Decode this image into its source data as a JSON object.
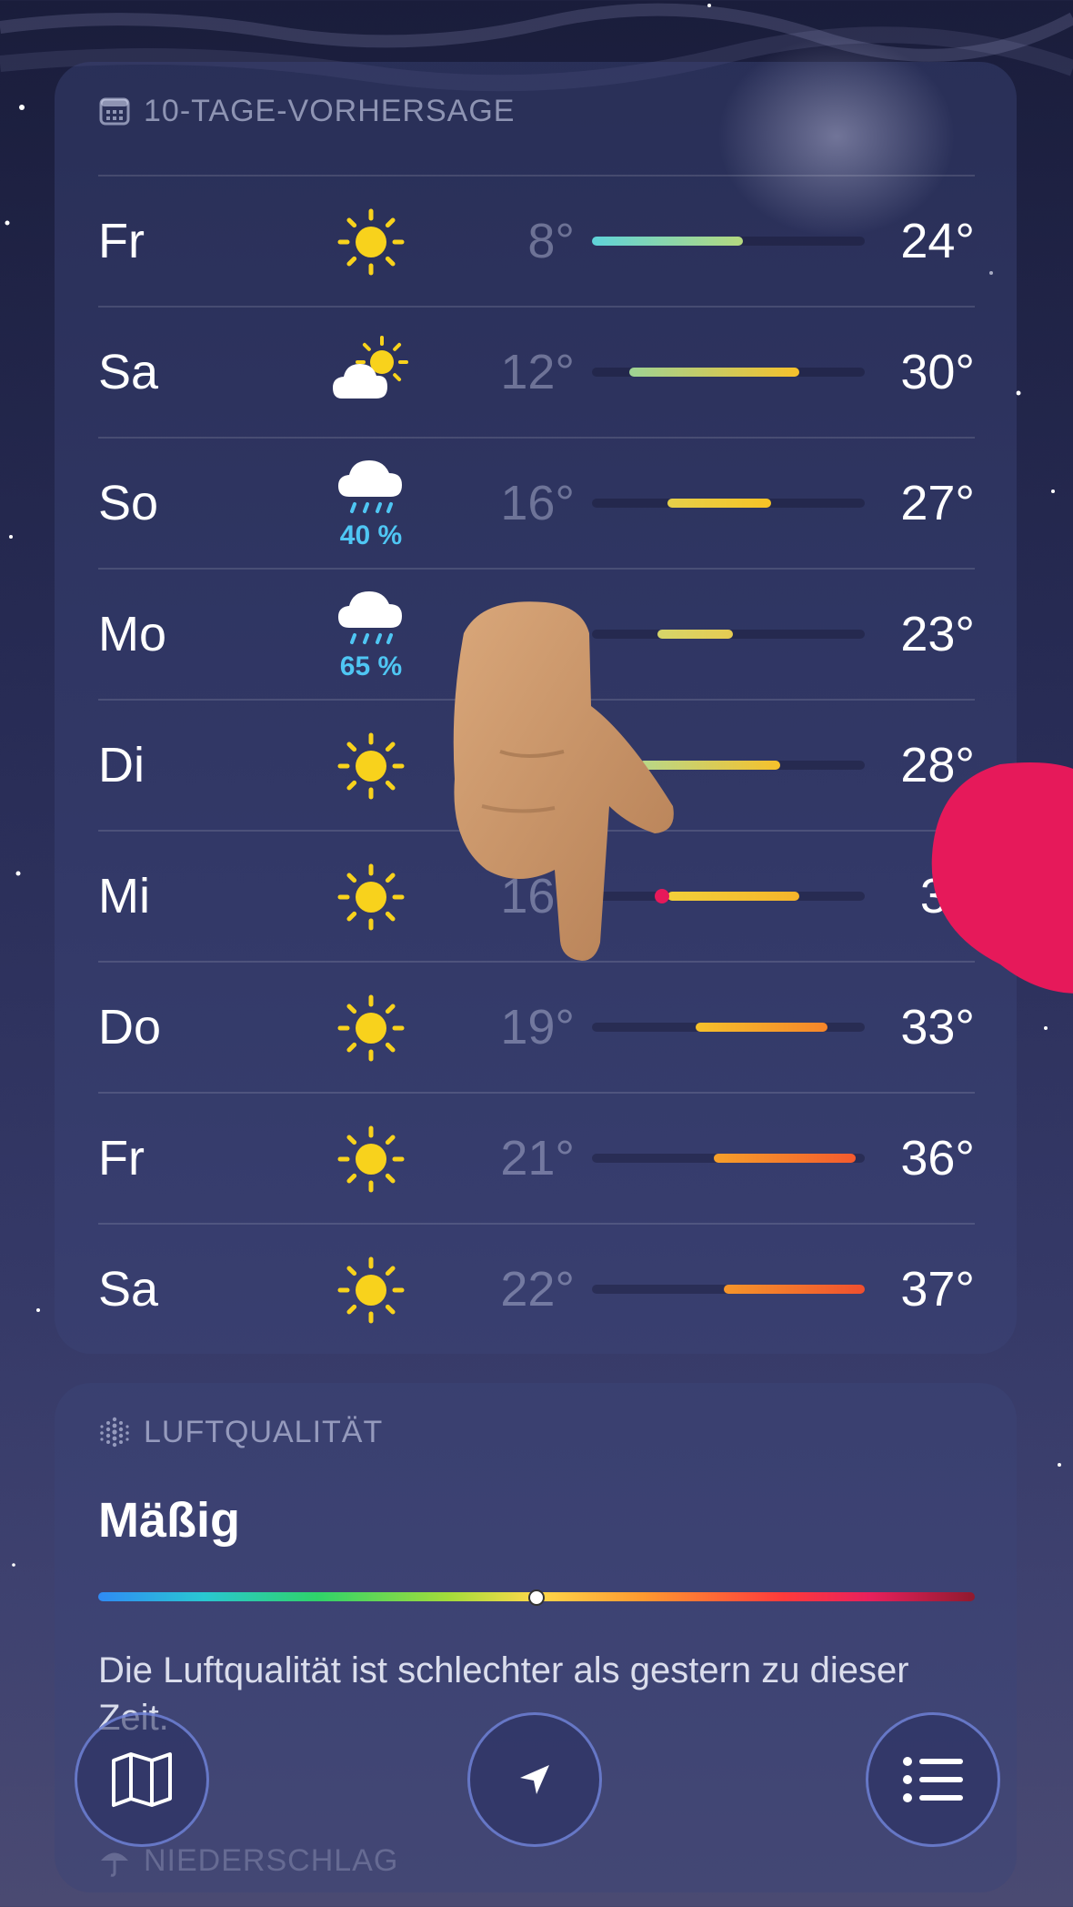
{
  "forecast": {
    "header": "10-TAGE-VORHERSAGE",
    "scale_min": 8,
    "scale_max": 37,
    "days": [
      {
        "day": "Fr",
        "icon": "sun-icon",
        "precip": "",
        "low": "8°",
        "high": "24°",
        "low_val": 8,
        "high_val": 24,
        "color_from": "#5fd3d9",
        "color_to": "#b5d97f"
      },
      {
        "day": "Sa",
        "icon": "partly-cloudy-icon",
        "precip": "",
        "low": "12°",
        "high": "30°",
        "low_val": 12,
        "high_val": 30,
        "color_from": "#9ed394",
        "color_to": "#f6c12b"
      },
      {
        "day": "So",
        "icon": "rain-cloud-icon",
        "precip": "40 %",
        "low": "16°",
        "high": "27°",
        "low_val": 16,
        "high_val": 27,
        "color_from": "#e6d04a",
        "color_to": "#f7c325"
      },
      {
        "day": "Mo",
        "icon": "rain-cloud-icon",
        "precip": "65 %",
        "low": "",
        "high": "23°",
        "low_val": 15,
        "high_val": 23,
        "color_from": "#d6d56a",
        "color_to": "#e6cc52"
      },
      {
        "day": "Di",
        "icon": "sun-icon",
        "precip": "",
        "low": "",
        "high": "28°",
        "low_val": 13,
        "high_val": 28,
        "color_from": "#b8d88a",
        "color_to": "#f6c12b"
      },
      {
        "day": "Mi",
        "icon": "sun-icon",
        "precip": "",
        "low": "16°",
        "high": "30",
        "low_val": 16,
        "high_val": 30,
        "color_from": "#f2d03a",
        "color_to": "#f6b42a"
      },
      {
        "day": "Do",
        "icon": "sun-icon",
        "precip": "",
        "low": "19°",
        "high": "33°",
        "low_val": 19,
        "high_val": 33,
        "color_from": "#f6c12b",
        "color_to": "#f6852a"
      },
      {
        "day": "Fr",
        "icon": "sun-icon",
        "precip": "",
        "low": "21°",
        "high": "36°",
        "low_val": 21,
        "high_val": 36,
        "color_from": "#f6a02a",
        "color_to": "#f45a2e"
      },
      {
        "day": "Sa",
        "icon": "sun-icon",
        "precip": "",
        "low": "22°",
        "high": "37°",
        "low_val": 22,
        "high_val": 37,
        "color_from": "#f6962a",
        "color_to": "#f04f2f"
      }
    ]
  },
  "air_quality": {
    "header": "LUFTQUALITÄT",
    "level": "Mäßig",
    "scale_position": 0.5,
    "description": "Die Luftqualität ist schlechter als gestern zu dieser Zeit."
  },
  "next_section": {
    "header": "NIEDERSCHLAG"
  },
  "toolbar": {
    "map_icon": "map-icon",
    "location_icon": "location-arrow-icon",
    "list_icon": "list-icon"
  },
  "colors": {
    "precip_text": "#4fc6f3",
    "sun": "#f8d21c",
    "accent_ring": "#788ce6",
    "marker_dot": "#e6195a"
  }
}
